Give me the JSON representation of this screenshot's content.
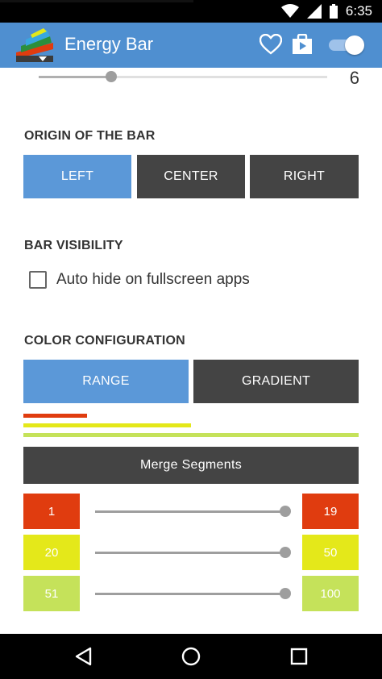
{
  "status_bar": {
    "time": "6:35",
    "icons": [
      "wifi-icon",
      "signal-icon",
      "battery-icon"
    ]
  },
  "app_bar": {
    "title": "Energy Bar",
    "actions": [
      "heart-icon",
      "store-bag-icon",
      "enable-toggle"
    ],
    "toggle_on": true
  },
  "top_slider": {
    "value": "6",
    "fraction": 0.25
  },
  "origin_section": {
    "title": "ORIGIN OF THE BAR",
    "buttons": [
      {
        "label": "LEFT",
        "selected": true
      },
      {
        "label": "CENTER",
        "selected": false
      },
      {
        "label": "RIGHT",
        "selected": false
      }
    ]
  },
  "visibility_section": {
    "title": "BAR VISIBILITY",
    "checkbox_label": "Auto hide on fullscreen apps",
    "checked": false
  },
  "color_section": {
    "title": "COLOR CONFIGURATION",
    "modes": [
      {
        "label": "RANGE",
        "selected": true
      },
      {
        "label": "GRADIENT",
        "selected": false
      }
    ],
    "preview_bars": [
      {
        "color": "#e03c0f",
        "fraction": 0.19
      },
      {
        "color": "#e4e81a",
        "fraction": 0.5
      },
      {
        "color": "#c5e25a",
        "fraction": 1.0
      }
    ],
    "merge_button": "Merge Segments",
    "segments": [
      {
        "from": "1",
        "to": "19",
        "color": "#e03c0f"
      },
      {
        "from": "20",
        "to": "50",
        "color": "#e4e81a"
      },
      {
        "from": "51",
        "to": "100",
        "color": "#c5e25a"
      }
    ]
  },
  "nav_bar": {
    "buttons": [
      "back-icon",
      "home-icon",
      "recents-icon"
    ]
  },
  "colors": {
    "app_bar": "#4f8fd0",
    "selected_button": "#5b98d8",
    "unselected_button": "#444444"
  }
}
